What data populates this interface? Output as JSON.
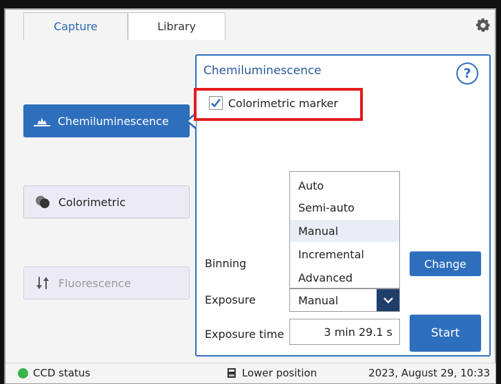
{
  "tabs": [
    {
      "label": "Capture",
      "active": true
    },
    {
      "label": "Library",
      "active": false
    }
  ],
  "modes": [
    {
      "label": "Chemiluminescence",
      "icon": "chemiluminescence-icon",
      "state": "selected"
    },
    {
      "label": "Colorimetric",
      "icon": "colorimetric-icon",
      "state": "normal"
    },
    {
      "label": "Fluorescence",
      "icon": "fluorescence-icon",
      "state": "disabled"
    }
  ],
  "panel": {
    "title": "Chemiluminescence",
    "help_label": "?",
    "colorimetric_marker": {
      "label": "Colorimetric marker",
      "checked": true
    },
    "binning_label": "Binning",
    "exposure_label": "Exposure",
    "exposure_time_label": "Exposure time",
    "exposure_options": [
      "Auto",
      "Semi-auto",
      "Manual",
      "Incremental",
      "Advanced"
    ],
    "exposure_selected": "Manual",
    "exposure_time_value": "3 min 29.1 s",
    "change_button": "Change",
    "start_button": "Start"
  },
  "status_bar": {
    "ccd_status": "CCD status",
    "position": "Lower position",
    "datetime": "2023, August 29, 10:33"
  },
  "colors": {
    "accent": "#2e6fbd",
    "highlight": "#e31b1b",
    "status_ok": "#39b54a"
  }
}
